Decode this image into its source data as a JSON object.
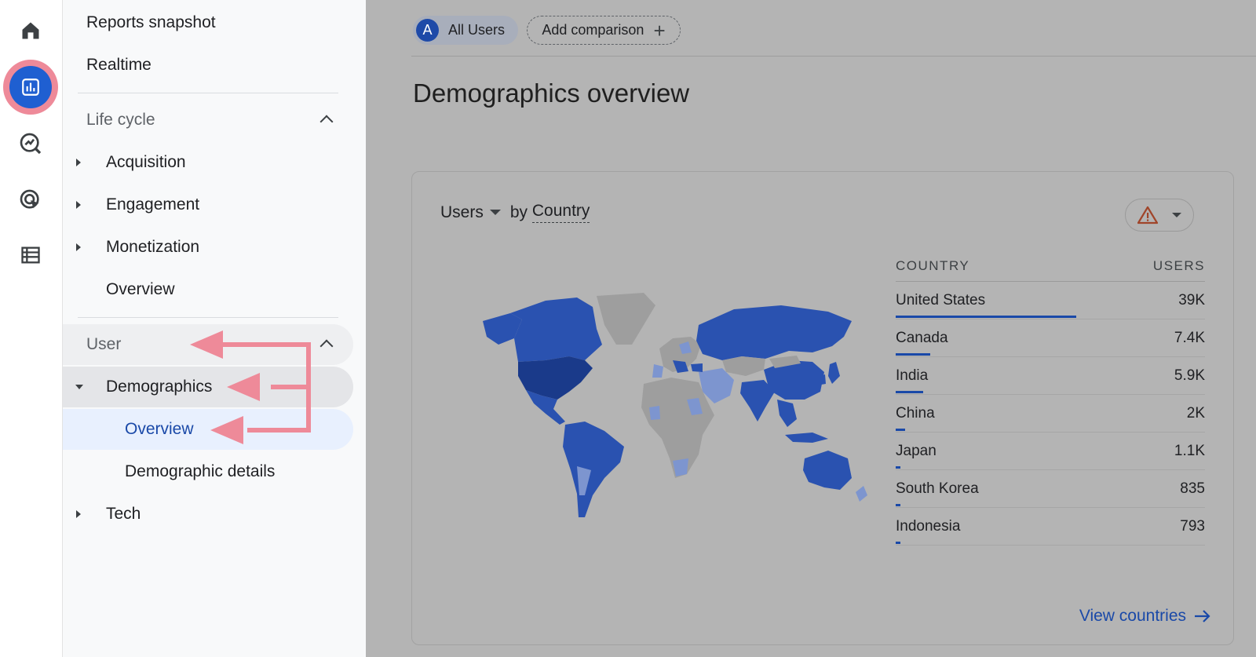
{
  "rail": {
    "icons": [
      "home-icon",
      "reports-icon",
      "explore-icon",
      "advertising-icon",
      "configure-icon"
    ]
  },
  "sidebar": {
    "reports_snapshot": "Reports snapshot",
    "realtime": "Realtime",
    "lifecycle": {
      "label": "Life cycle",
      "items": [
        "Acquisition",
        "Engagement",
        "Monetization",
        "Overview"
      ]
    },
    "user": {
      "label": "User",
      "demographics": "Demographics",
      "demographics_children": [
        "Overview",
        "Demographic details"
      ],
      "tech": "Tech"
    }
  },
  "main": {
    "comparison_chip": {
      "avatar": "A",
      "label": "All Users"
    },
    "add_comparison": "Add comparison",
    "title": "Demographics overview",
    "card": {
      "metric": "Users",
      "by": "by",
      "dimension": "Country",
      "table_headers": {
        "country": "COUNTRY",
        "users": "USERS"
      },
      "view_link": "View countries"
    }
  },
  "chart_data": {
    "type": "table",
    "columns": [
      "COUNTRY",
      "USERS"
    ],
    "rows": [
      {
        "country": "United States",
        "users": "39K",
        "value": 39000
      },
      {
        "country": "Canada",
        "users": "7.4K",
        "value": 7400
      },
      {
        "country": "India",
        "users": "5.9K",
        "value": 5900
      },
      {
        "country": "China",
        "users": "2K",
        "value": 2000
      },
      {
        "country": "Japan",
        "users": "1.1K",
        "value": 1100
      },
      {
        "country": "South Korea",
        "users": "835",
        "value": 835
      },
      {
        "country": "Indonesia",
        "users": "793",
        "value": 793
      }
    ]
  },
  "colors": {
    "accent": "#1a49a8",
    "annotation": "#ee8a99",
    "selected_bg": "#e8f0fe",
    "map_dark": "#1a3a8a",
    "map_mid": "#2a52b0",
    "map_light": "#7d95cf",
    "map_none": "#9e9e9e"
  }
}
